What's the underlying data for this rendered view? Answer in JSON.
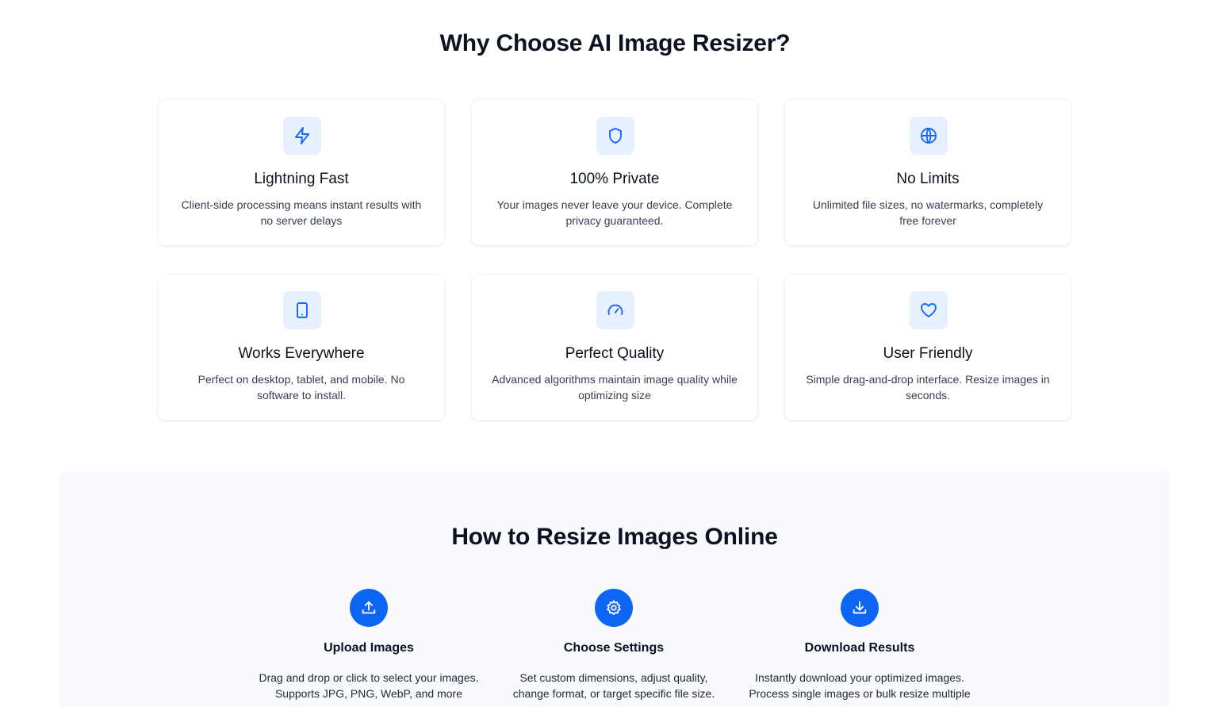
{
  "why_section": {
    "title": "Why Choose AI Image Resizer?",
    "features": [
      {
        "icon": "lightning-icon",
        "title": "Lightning Fast",
        "desc": "Client-side processing means instant results with no server delays"
      },
      {
        "icon": "shield-icon",
        "title": "100% Private",
        "desc": "Your images never leave your device. Complete privacy guaranteed."
      },
      {
        "icon": "globe-icon",
        "title": "No Limits",
        "desc": "Unlimited file sizes, no watermarks, completely free forever"
      },
      {
        "icon": "tablet-icon",
        "title": "Works Everywhere",
        "desc": "Perfect on desktop, tablet, and mobile. No software to install."
      },
      {
        "icon": "gauge-icon",
        "title": "Perfect Quality",
        "desc": "Advanced algorithms maintain image quality while optimizing size"
      },
      {
        "icon": "heart-icon",
        "title": "User Friendly",
        "desc": "Simple drag-and-drop interface. Resize images in seconds."
      }
    ]
  },
  "how_section": {
    "title": "How to Resize Images Online",
    "steps": [
      {
        "icon": "upload-icon",
        "title": "Upload Images",
        "desc": "Drag and drop or click to select your images. Supports JPG, PNG, WebP, and more"
      },
      {
        "icon": "gear-icon",
        "title": "Choose Settings",
        "desc": "Set custom dimensions, adjust quality, change format, or target specific file size."
      },
      {
        "icon": "download-icon",
        "title": "Download Results",
        "desc": "Instantly download your optimized images. Process single images or bulk resize multiple"
      }
    ]
  },
  "colors": {
    "accent": "#0d66f3",
    "icon_bg": "#e7f0ff",
    "section_bg": "#f8fafd"
  }
}
